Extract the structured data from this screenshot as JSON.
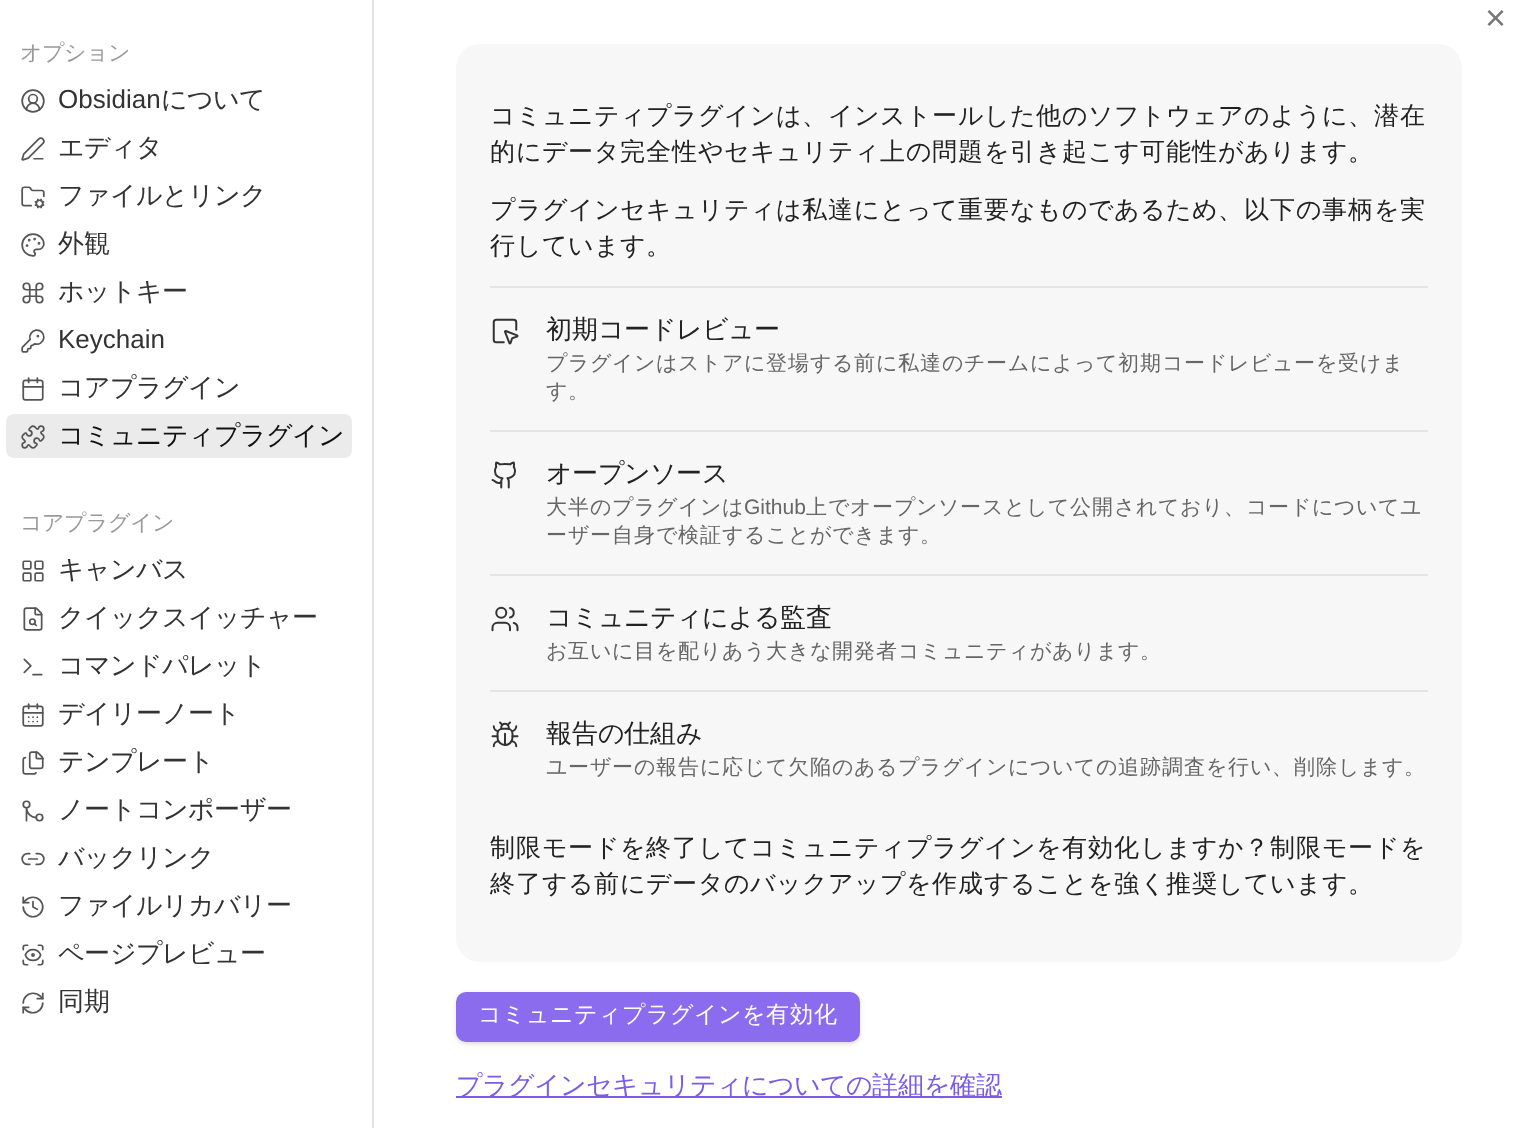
{
  "sidebar": {
    "sections": [
      {
        "heading": "オプション",
        "items": [
          {
            "label": "Obsidianについて",
            "selected": false
          },
          {
            "label": "エディタ",
            "selected": false
          },
          {
            "label": "ファイルとリンク",
            "selected": false
          },
          {
            "label": "外観",
            "selected": false
          },
          {
            "label": "ホットキー",
            "selected": false
          },
          {
            "label": "Keychain",
            "selected": false
          },
          {
            "label": "コアプラグイン",
            "selected": false
          },
          {
            "label": "コミュニティプラグイン",
            "selected": true
          }
        ]
      },
      {
        "heading": "コアプラグイン",
        "items": [
          {
            "label": "キャンバス",
            "selected": false
          },
          {
            "label": "クイックスイッチャー",
            "selected": false
          },
          {
            "label": "コマンドパレット",
            "selected": false
          },
          {
            "label": "デイリーノート",
            "selected": false
          },
          {
            "label": "テンプレート",
            "selected": false
          },
          {
            "label": "ノートコンポーザー",
            "selected": false
          },
          {
            "label": "バックリンク",
            "selected": false
          },
          {
            "label": "ファイルリカバリー",
            "selected": false
          },
          {
            "label": "ページプレビュー",
            "selected": false
          },
          {
            "label": "同期",
            "selected": false
          }
        ]
      }
    ]
  },
  "close": "×",
  "notice": {
    "intro": [
      "コミュニティプラグインは、インストールした他のソフトウェアのように、潜在的にデータ完全性やセキュリティ上の問題を引き起こす可能性があります。",
      "プラグインセキュリティは私達にとって重要なものであるため、以下の事柄を実行しています。"
    ],
    "features": [
      {
        "title": "初期コードレビュー",
        "description": "プラグインはストアに登場する前に私達のチームによって初期コードレビューを受けます。"
      },
      {
        "title": "オープンソース",
        "description": "大半のプラグインはGithub上でオープンソースとして公開されており、コードについてユーザー自身で検証することができます。"
      },
      {
        "title": "コミュニティによる監査",
        "description": "お互いに目を配りあう大きな開発者コミュニティがあります。"
      },
      {
        "title": "報告の仕組み",
        "description": "ユーザーの報告に応じて欠陥のあるプラグインについての追跡調査を行い、削除します。"
      }
    ],
    "outro": "制限モードを終了してコミュニティプラグインを有効化しますか？制限モードを終了する前にデータのバックアップを作成することを強く推奨しています。"
  },
  "enable_button": "コミュニティプラグインを有効化",
  "details_link": "プラグインセキュリティについての詳細を確認"
}
